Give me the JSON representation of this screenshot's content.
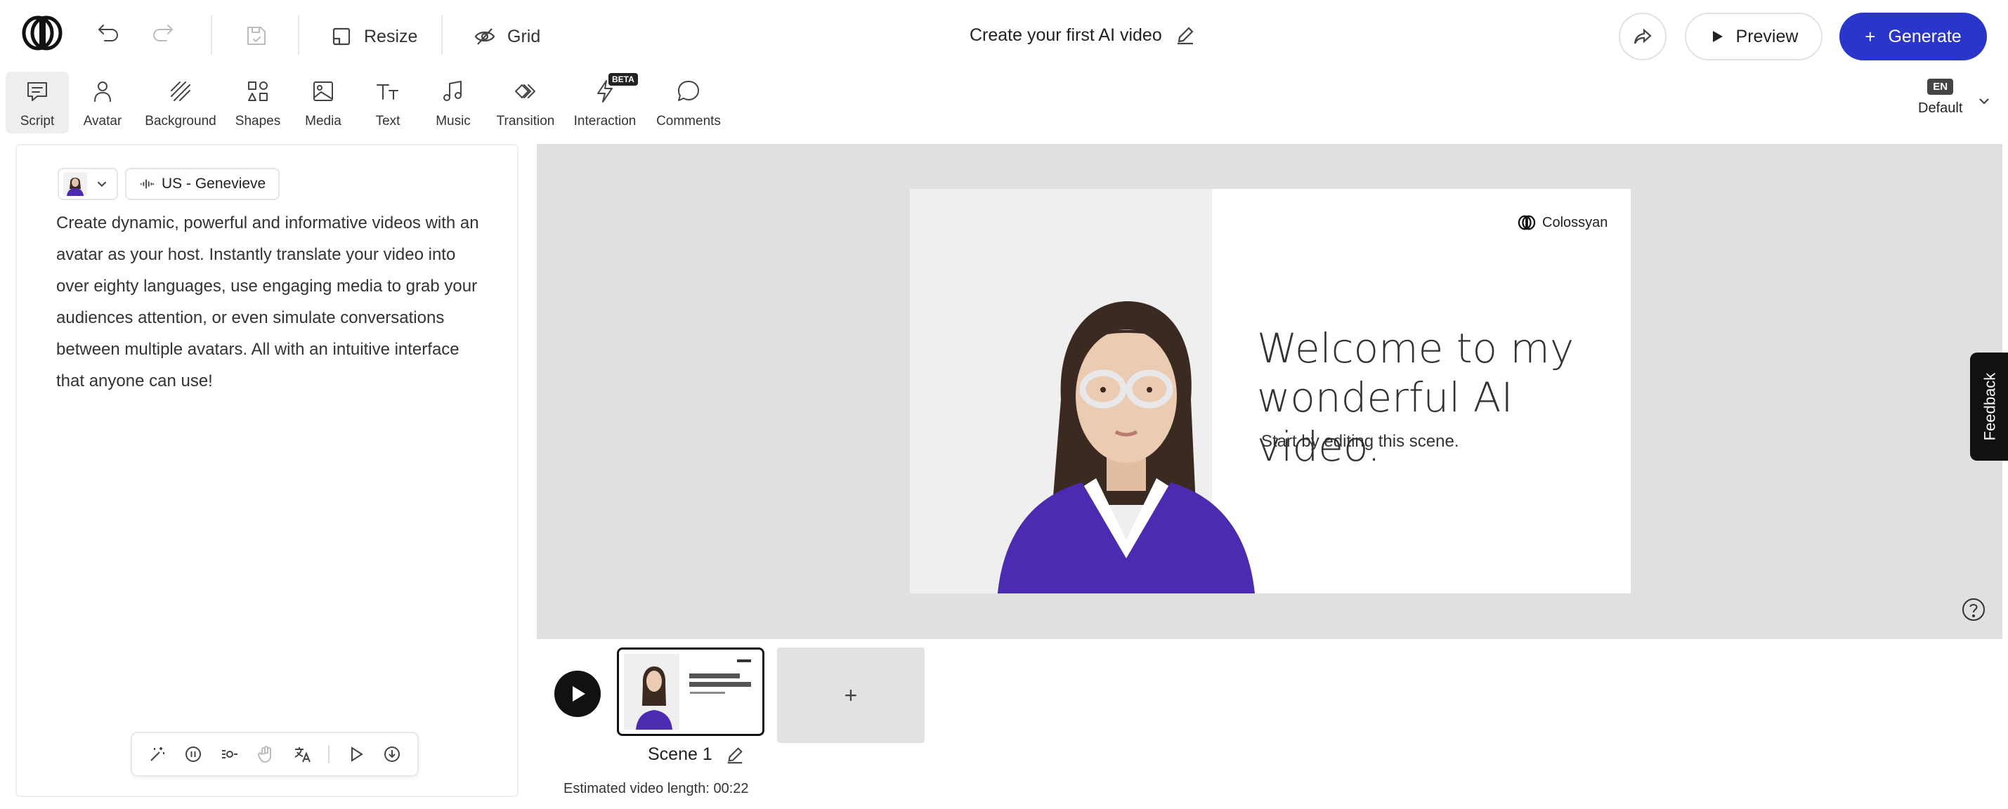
{
  "header": {
    "title": "Create your first AI video",
    "resize_label": "Resize",
    "grid_label": "Grid",
    "preview_label": "Preview",
    "generate_label": "Generate"
  },
  "toolbar": {
    "items": [
      {
        "label": "Script",
        "icon": "script-icon"
      },
      {
        "label": "Avatar",
        "icon": "avatar-icon"
      },
      {
        "label": "Background",
        "icon": "background-icon"
      },
      {
        "label": "Shapes",
        "icon": "shapes-icon"
      },
      {
        "label": "Media",
        "icon": "media-icon"
      },
      {
        "label": "Text",
        "icon": "text-icon"
      },
      {
        "label": "Music",
        "icon": "music-icon"
      },
      {
        "label": "Transition",
        "icon": "transition-icon"
      },
      {
        "label": "Interaction",
        "icon": "interaction-icon",
        "badge": "BETA"
      },
      {
        "label": "Comments",
        "icon": "comments-icon"
      }
    ],
    "active": "Script",
    "language_code": "EN",
    "language_label": "Default"
  },
  "script_panel": {
    "voice": "US - Genevieve",
    "text": "Create dynamic, powerful and informative videos with an avatar as your host. Instantly translate your video into over eighty languages, use engaging media to grab your audiences attention, or even simulate conversations between multiple avatars. All with an intuitive interface that anyone can use!"
  },
  "slide": {
    "brand": "Colossyan",
    "headline": "Welcome to my wonderful AI video.",
    "subtext": "Start by editing this scene."
  },
  "feedback_label": "Feedback",
  "timeline": {
    "scene_label": "Scene 1",
    "add_label": "+",
    "estimate": "Estimated video length: 00:22"
  },
  "colors": {
    "accent": "#2a36c9",
    "sweater": "#4b2bb0",
    "canvas_bg": "#e0e0e0"
  }
}
